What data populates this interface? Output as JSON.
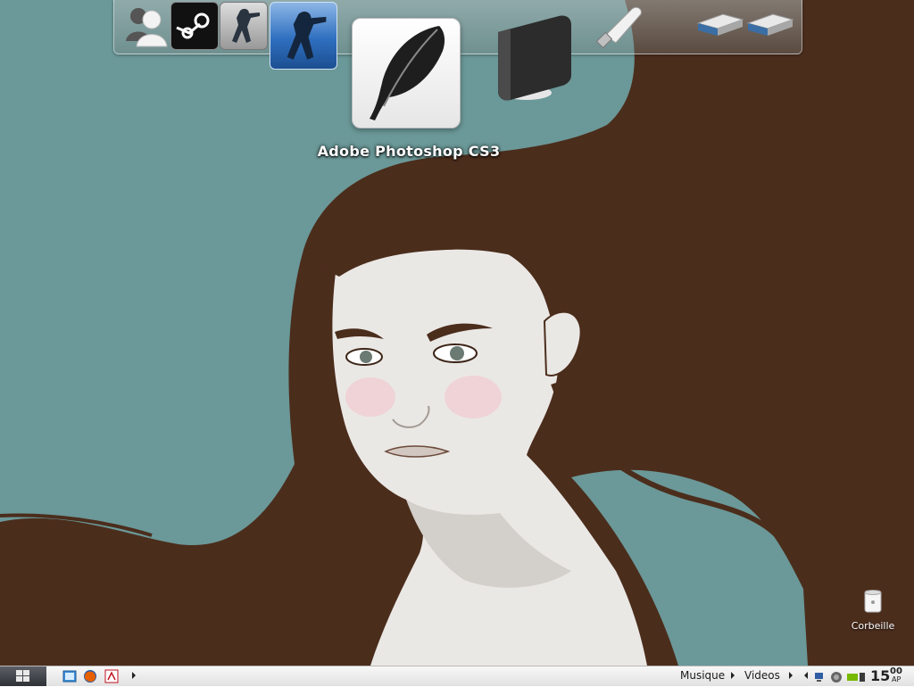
{
  "colors": {
    "sky": "#6b9898",
    "hair": "#4b2d1c",
    "skin": "#eae8e5",
    "skin_shadow": "#d3cfca",
    "blush": "#efd3d6",
    "accent_blue": "#2f6fbf"
  },
  "dock": {
    "items": [
      {
        "icon": "messenger-icon"
      },
      {
        "icon": "steam-icon"
      },
      {
        "icon": "counter-strike-icon"
      },
      {
        "icon": "counter-strike-source-icon"
      },
      {
        "icon": "photoshop-feather-icon"
      },
      {
        "icon": "external-hard-drive-icon"
      },
      {
        "icon": "usb-drive-icon"
      },
      {
        "icon": "hard-drive-icon"
      },
      {
        "icon": "hard-drive-icon"
      }
    ],
    "hover_label": "Adobe Photoshop CS3"
  },
  "desktop_icons": [
    {
      "icon": "recycle-bin-icon",
      "label": "Corbeille"
    }
  ],
  "taskbar": {
    "start_icon": "windows-logo-icon",
    "quick_launch": [
      {
        "icon": "show-desktop-icon"
      },
      {
        "icon": "firefox-icon"
      },
      {
        "icon": "adobe-reader-icon"
      }
    ],
    "toolbars": [
      {
        "label": "Musique"
      },
      {
        "label": "Videos"
      }
    ],
    "tray_icons": [
      "network-icon",
      "volume-icon",
      "nvidia-icon",
      "system-icon"
    ],
    "clock": {
      "hour": "15",
      "minute": "00",
      "period": "AP"
    }
  }
}
